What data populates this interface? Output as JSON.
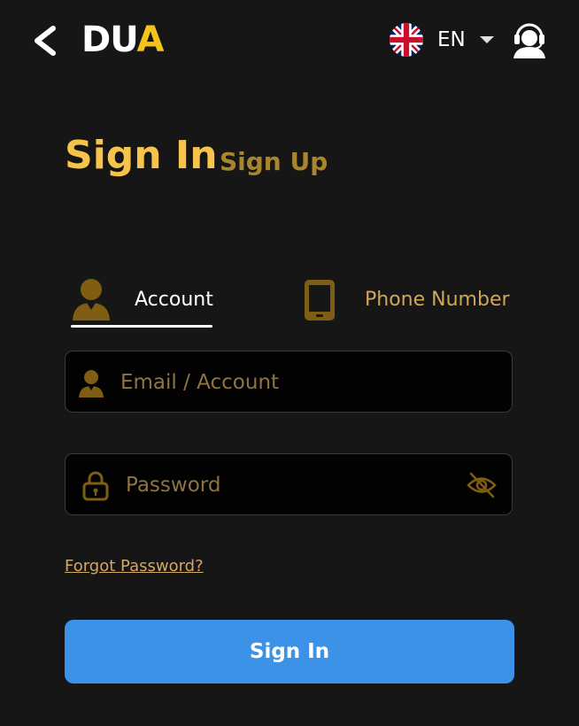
{
  "header": {
    "logo_main": "DU",
    "logo_accent": "A",
    "language_code": "EN"
  },
  "auth_tabs": {
    "sign_in": "Sign In",
    "sign_up": "Sign Up"
  },
  "method_tabs": {
    "account": "Account",
    "phone": "Phone Number",
    "active": "account"
  },
  "form": {
    "email": {
      "placeholder": "Email / Account",
      "value": ""
    },
    "password": {
      "placeholder": "Password",
      "value": ""
    },
    "forgot_password": "Forgot Password?",
    "submit_label": "Sign In"
  },
  "colors": {
    "background": "#161616",
    "accent_gold": "#f6c44c",
    "muted_gold": "#a8862d",
    "primary_button": "#3b92e6",
    "field_background": "#020202"
  },
  "icons": {
    "back": "chevron-left-icon",
    "language": "uk-flag-icon",
    "language_dropdown": "caret-down-icon",
    "support": "customer-support-icon",
    "account": "user-icon",
    "phone": "smartphone-icon",
    "email": "user-icon",
    "password": "lock-icon",
    "visibility": "eye-off-icon"
  }
}
